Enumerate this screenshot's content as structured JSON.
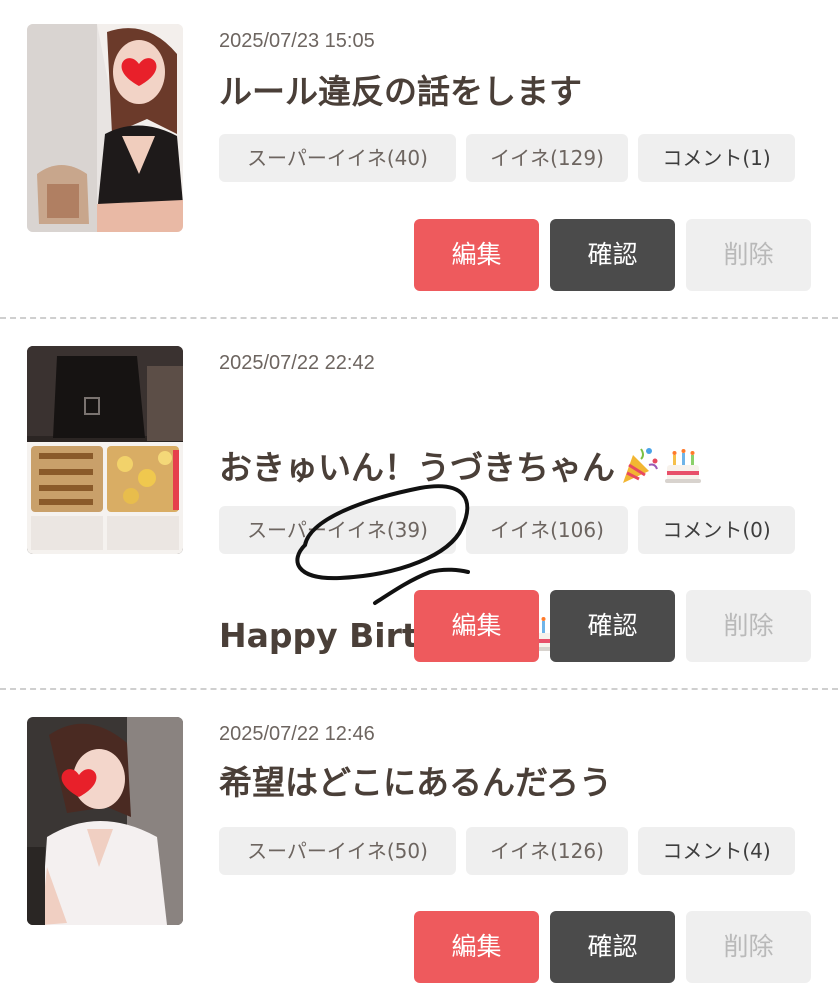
{
  "posts": [
    {
      "date": "2025/07/23 15:05",
      "title": "ルール違反の話をします",
      "super_like": "スーパーイイネ(40)",
      "like": "イイネ(129)",
      "comment": "コメント(1)",
      "edit": "編集",
      "confirm": "確認",
      "delete": "削除"
    },
    {
      "date": "2025/07/22 22:42",
      "title_line1": "おきゅいん！うづきちゃん",
      "title_line2": "Happy Birthday ",
      "super_like": "スーパーイイネ(39)",
      "like": "イイネ(106)",
      "comment": "コメント(0)",
      "edit": "編集",
      "confirm": "確認",
      "delete": "削除"
    },
    {
      "date": "2025/07/22 12:46",
      "title": "希望はどこにあるんだろう",
      "super_like": "スーパーイイネ(50)",
      "like": "イイネ(126)",
      "comment": "コメント(4)",
      "edit": "編集",
      "confirm": "確認",
      "delete": "削除"
    }
  ],
  "emoji_icons": [
    "party-popper-icon",
    "birthday-cake-icon"
  ],
  "colors": {
    "edit_button": "#ee5a5d",
    "confirm_button": "#4b4b4b",
    "delete_button": "#efefef",
    "tag_background": "#efefef",
    "title_text": "#4a3f38"
  }
}
